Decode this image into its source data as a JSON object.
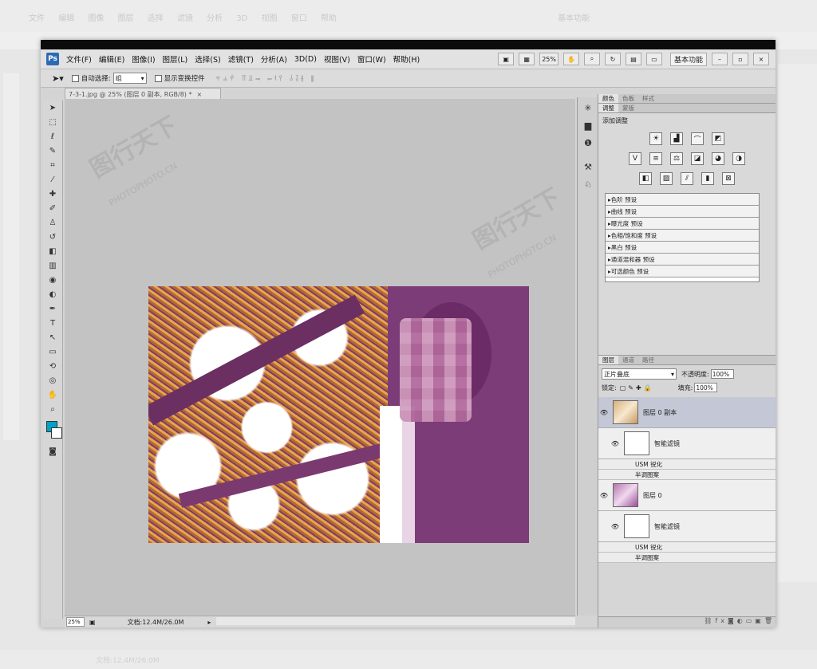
{
  "bg_app": {
    "menus": [
      "文件",
      "编辑",
      "图像",
      "图层",
      "选择",
      "滤镜",
      "分析",
      "3D",
      "视图",
      "窗口",
      "帮助"
    ],
    "workspace": "基本功能",
    "status": "文档:12.4M/26.0M"
  },
  "app": {
    "logo": "Ps",
    "menus": [
      "文件(F)",
      "编辑(E)",
      "图像(I)",
      "图层(L)",
      "选择(S)",
      "滤镜(T)",
      "分析(A)",
      "3D(D)",
      "视图(V)",
      "窗口(W)",
      "帮助(H)"
    ],
    "zoom_menu": "25%",
    "workspace": "基本功能"
  },
  "options_bar": {
    "auto_select_label": "自动选择:",
    "auto_select_value": "组",
    "show_transform_label": "显示变换控件"
  },
  "document": {
    "tab_title": "7-3-1.jpg @ 25% (图层 0 副本, RGB/8) *",
    "zoom": "25%",
    "doc_info": "文档:12.4M/26.0M"
  },
  "watermark": {
    "brand": "图行天下",
    "url": "PHOTOPHOTO.CN"
  },
  "panels": {
    "top_tabs": [
      "颜色",
      "色板",
      "样式"
    ],
    "adj_tabs": [
      "调整",
      "蒙版"
    ],
    "adj_title": "添加调整",
    "presets": [
      "色阶 预设",
      "曲线 预设",
      "曝光度 预设",
      "色相/饱和度 预设",
      "黑白 预设",
      "通道混和器 预设",
      "可选颜色 预设"
    ],
    "layer_tabs": [
      "图层",
      "通道",
      "路径"
    ],
    "blend_mode": "正片叠底",
    "opacity_label": "不透明度:",
    "opacity_value": "100%",
    "lock_label": "锁定:",
    "fill_label": "填充:",
    "fill_value": "100%",
    "layers": [
      {
        "name": "图层 0 副本",
        "smart_filter": "智能滤镜",
        "filters": [
          "USM 锐化",
          "半调图案"
        ]
      },
      {
        "name": "图层 0",
        "smart_filter": "智能滤镜",
        "filters": [
          "USM 锐化",
          "半调图案"
        ]
      }
    ]
  }
}
